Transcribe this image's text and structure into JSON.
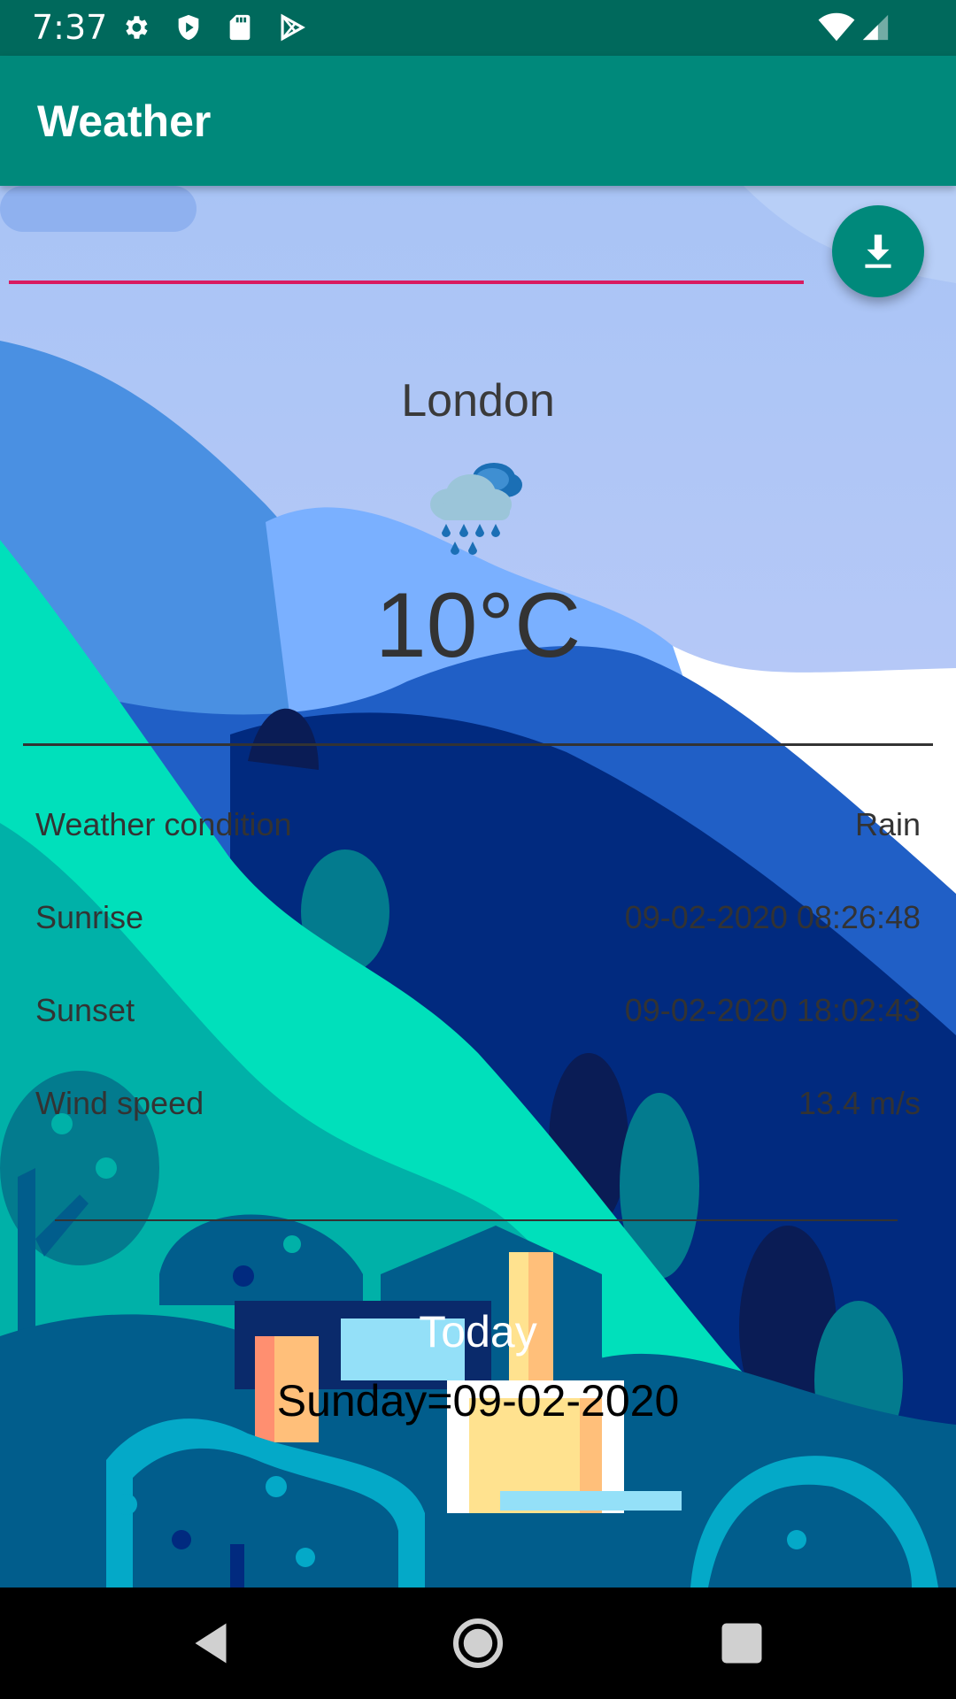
{
  "status_bar": {
    "time": "7:37",
    "icons": [
      "gear-icon",
      "shield-icon",
      "sd-card-icon",
      "play-store-icon",
      "wifi-icon",
      "signal-icon"
    ]
  },
  "app_bar": {
    "title": "Weather"
  },
  "search": {
    "value": ""
  },
  "fab": {
    "icon": "download-icon"
  },
  "weather": {
    "city": "London",
    "icon": "rain-cloud-icon",
    "temperature": "10°C"
  },
  "details": [
    {
      "label": "Weather condition",
      "value": "Rain"
    },
    {
      "label": "Sunrise",
      "value": "09-02-2020 08:26:48"
    },
    {
      "label": "Sunset",
      "value": "09-02-2020 18:02:43"
    },
    {
      "label": "Wind speed",
      "value": "13.4 m/s"
    }
  ],
  "today": {
    "label": "Today",
    "date": "Sunday=09-02-2020"
  },
  "nav_bar": {
    "icons": [
      "back-icon",
      "home-icon",
      "recents-icon"
    ]
  },
  "colors": {
    "status_bar": "#00695c",
    "app_bar": "#00897b",
    "accent": "#d81b60",
    "sky_top": "#a9c4f5",
    "sky_bottom": "#ccd0fb",
    "teal_hill": "#00e0bb",
    "dark_blue": "#012a7f"
  }
}
